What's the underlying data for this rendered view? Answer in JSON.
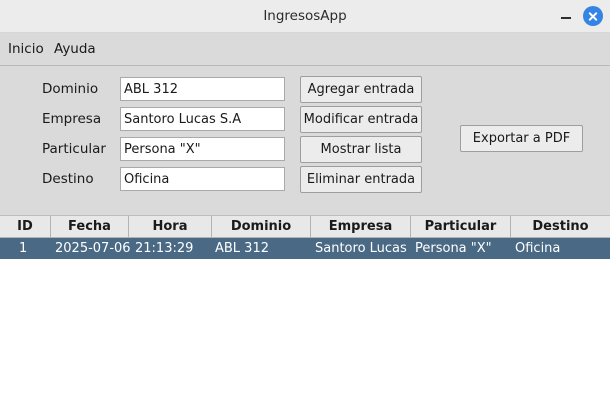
{
  "window": {
    "title": "IngresosApp"
  },
  "menu": {
    "items": [
      "Inicio",
      "Ayuda"
    ]
  },
  "form": {
    "fields": [
      {
        "label": "Dominio",
        "value": "ABL 312"
      },
      {
        "label": "Empresa",
        "value": "Santoro Lucas S.A"
      },
      {
        "label": "Particular",
        "value": "Persona \"X\""
      },
      {
        "label": "Destino",
        "value": "Oficina"
      }
    ],
    "buttons": {
      "add": "Agregar entrada",
      "modify": "Modificar entrada",
      "show": "Mostrar lista",
      "delete": "Eliminar entrada",
      "export": "Exportar a PDF"
    }
  },
  "table": {
    "columns": [
      "ID",
      "Fecha",
      "Hora",
      "Dominio",
      "Empresa",
      "Particular",
      "Destino"
    ],
    "rows": [
      [
        "1",
        "2025-07-06",
        "21:13:29",
        "ABL 312",
        "Santoro Lucas S.A",
        "Persona \"X\"",
        "Oficina"
      ]
    ],
    "selected_row_color": "#4a6984"
  }
}
